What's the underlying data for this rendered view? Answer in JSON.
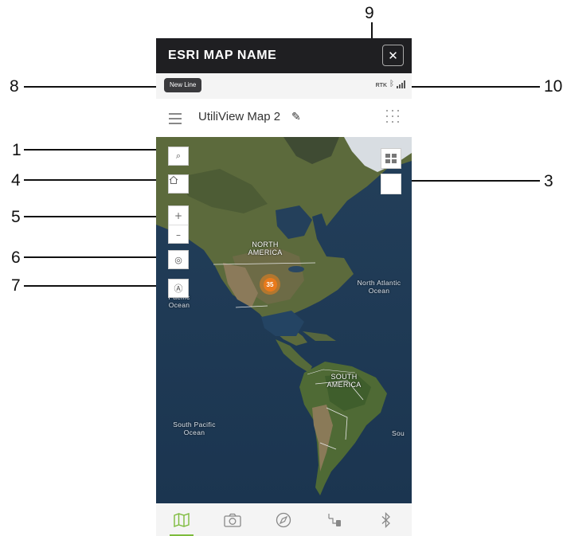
{
  "callouts": {
    "c1": "1",
    "c3": "3",
    "c4": "4",
    "c5": "5",
    "c6": "6",
    "c7": "7",
    "c8": "8",
    "c9": "9",
    "c10": "10"
  },
  "app": {
    "title": "ESRI MAP NAME",
    "close_glyph": "✕"
  },
  "statusbar": {
    "badge": "New Line",
    "gps_label": "RTK",
    "bluetooth_glyph": "ᛒ"
  },
  "map_header": {
    "map_name": "UtiliView Map 2",
    "edit_glyph": "✎"
  },
  "map_controls": {
    "search_glyph": "⌕",
    "zoom_in": "+",
    "zoom_out": "–",
    "locate_glyph": "◎",
    "account_glyph": "Ⓐ"
  },
  "map_labels": {
    "north_america": "NORTH AMERICA",
    "south_america": "SOUTH AMERICA",
    "north_atlantic": "North Atlantic Ocean",
    "pacific": "Pacific Ocean",
    "south_pacific": "South Pacific Ocean",
    "south_edge": "Sou"
  },
  "cluster": {
    "count": "35"
  },
  "nav": {
    "items": [
      {
        "icon": "map-icon",
        "active": true
      },
      {
        "icon": "camera-icon",
        "active": false
      },
      {
        "icon": "compass-icon",
        "active": false
      },
      {
        "icon": "gps-device-icon",
        "active": false
      },
      {
        "icon": "bluetooth-icon",
        "active": false
      }
    ]
  },
  "colors": {
    "titlebar": "#1f1f22",
    "accent": "#7dbb3c",
    "cluster": "#e97a1c",
    "ocean": "#1d3b55"
  }
}
